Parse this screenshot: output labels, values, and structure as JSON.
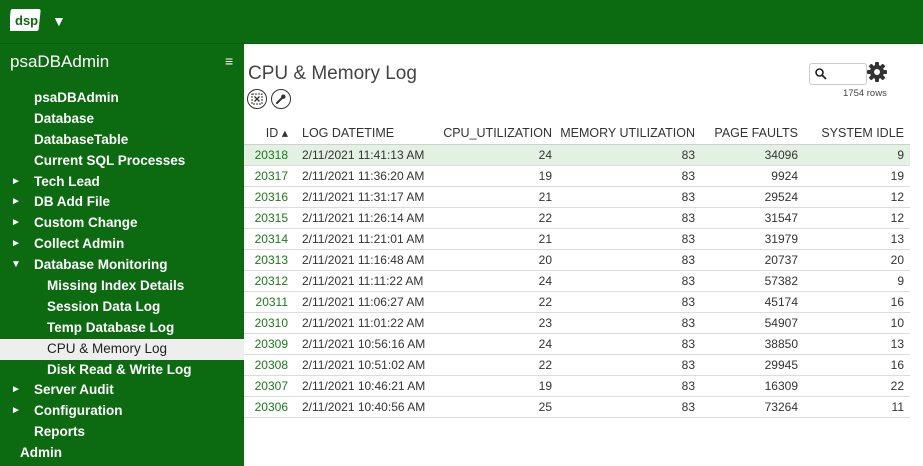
{
  "header": {
    "logo_text": "dsp",
    "logo_caret": "▼"
  },
  "sidebar": {
    "title": "psaDBAdmin",
    "menu_glyph": "≡",
    "items": [
      {
        "label": "psaDBAdmin",
        "arrow": "",
        "level": 0
      },
      {
        "label": "Database",
        "arrow": "",
        "level": 0
      },
      {
        "label": "DatabaseTable",
        "arrow": "",
        "level": 0
      },
      {
        "label": "Current SQL Processes",
        "arrow": "",
        "level": 0
      },
      {
        "label": "Tech Lead",
        "arrow": "►",
        "level": 0
      },
      {
        "label": "DB Add File",
        "arrow": "►",
        "level": 0
      },
      {
        "label": "Custom Change",
        "arrow": "►",
        "level": 0
      },
      {
        "label": "Collect Admin",
        "arrow": "►",
        "level": 0
      },
      {
        "label": "Database Monitoring",
        "arrow": "▼",
        "level": 0
      },
      {
        "label": "Missing Index Details",
        "arrow": "",
        "level": 1
      },
      {
        "label": "Session Data Log",
        "arrow": "",
        "level": 1
      },
      {
        "label": "Temp Database Log",
        "arrow": "",
        "level": 1
      },
      {
        "label": "CPU & Memory Log",
        "arrow": "",
        "level": 1,
        "active": true
      },
      {
        "label": "Disk Read & Write Log",
        "arrow": "",
        "level": 1
      },
      {
        "label": "Server Audit",
        "arrow": "►",
        "level": 0
      },
      {
        "label": "Configuration",
        "arrow": "►",
        "level": 0
      },
      {
        "label": "Reports",
        "arrow": "",
        "level": 0
      },
      {
        "label": "Admin",
        "arrow": "",
        "level": -1
      }
    ]
  },
  "main": {
    "title": "CPU & Memory Log",
    "row_count": "1754 rows",
    "icons": [
      "clear-filter-icon",
      "wrench-icon",
      "search-icon",
      "gear-icon"
    ],
    "columns": [
      "ID ▴",
      "LOG DATETIME",
      "CPU_UTILIZATION",
      "MEMORY UTILIZATION",
      "PAGE FAULTS",
      "SYSTEM IDLE"
    ],
    "rows": [
      [
        "20318",
        "2/11/2021 11:41:13 AM",
        "24",
        "83",
        "34096",
        "9"
      ],
      [
        "20317",
        "2/11/2021 11:36:20 AM",
        "19",
        "83",
        "9924",
        "19"
      ],
      [
        "20316",
        "2/11/2021 11:31:17 AM",
        "21",
        "83",
        "29524",
        "12"
      ],
      [
        "20315",
        "2/11/2021 11:26:14 AM",
        "22",
        "83",
        "31547",
        "12"
      ],
      [
        "20314",
        "2/11/2021 11:21:01 AM",
        "21",
        "83",
        "31979",
        "13"
      ],
      [
        "20313",
        "2/11/2021 11:16:48 AM",
        "20",
        "83",
        "20737",
        "20"
      ],
      [
        "20312",
        "2/11/2021 11:11:22 AM",
        "24",
        "83",
        "57382",
        "9"
      ],
      [
        "20311",
        "2/11/2021 11:06:27 AM",
        "22",
        "83",
        "45174",
        "16"
      ],
      [
        "20310",
        "2/11/2021 11:01:22 AM",
        "23",
        "83",
        "54907",
        "10"
      ],
      [
        "20309",
        "2/11/2021 10:56:16 AM",
        "24",
        "83",
        "38850",
        "13"
      ],
      [
        "20308",
        "2/11/2021 10:51:02 AM",
        "22",
        "83",
        "29945",
        "16"
      ],
      [
        "20307",
        "2/11/2021 10:46:21 AM",
        "19",
        "83",
        "16309",
        "22"
      ],
      [
        "20306",
        "2/11/2021 10:40:56 AM",
        "25",
        "83",
        "73264",
        "11"
      ]
    ]
  },
  "colors": {
    "brand_green": "#0c6a10",
    "link_green": "#1a7a1a",
    "selected_row": "#e3f1e3"
  }
}
